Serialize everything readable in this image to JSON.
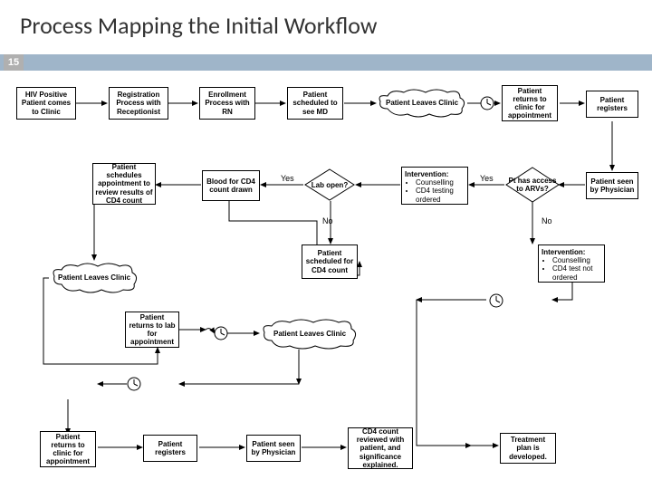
{
  "title": "Process Mapping the Initial Workflow",
  "page_number": "15",
  "labels": {
    "yes": "Yes",
    "no": "No"
  },
  "nodes": {
    "r1a": "HIV Positive Patient comes to Clinic",
    "r1b": "Registration Process with Receptionist",
    "r1c": "Enrollment Process with RN",
    "r1d": "Patient scheduled to see MD",
    "r1e": "Patient Leaves Clinic",
    "r1f": "Patient returns to clinic for appointment",
    "r1g": "Patient registers",
    "r2g": "Patient seen by Physician",
    "r2f": "Pt has access to ARVs?",
    "intv1_h": "Intervention:",
    "intv1_a": "Counselling",
    "intv1_b": "CD4 testing ordered",
    "r2d": "Lab open?",
    "r2c": "Blood for CD4 count drawn",
    "r2a": "Patient schedules appointment to review results of CD4 count",
    "r3a": "Patient Leaves Clinic",
    "r3d": "Patient scheduled for CD4 count",
    "intv2_h": "Intervention:",
    "intv2_a": "Counselling",
    "intv2_b": "CD4 test not ordered",
    "r4b": "Patient returns to lab for appointment",
    "r4d": "Patient Leaves Clinic",
    "r5a": "Patient returns to clinic for appointment",
    "r5b": "Patient registers",
    "r5c": "Patient seen by Physician",
    "r5d": "CD4 count reviewed with patient, and significance explained.",
    "r5f": "Treatment plan is developed."
  }
}
